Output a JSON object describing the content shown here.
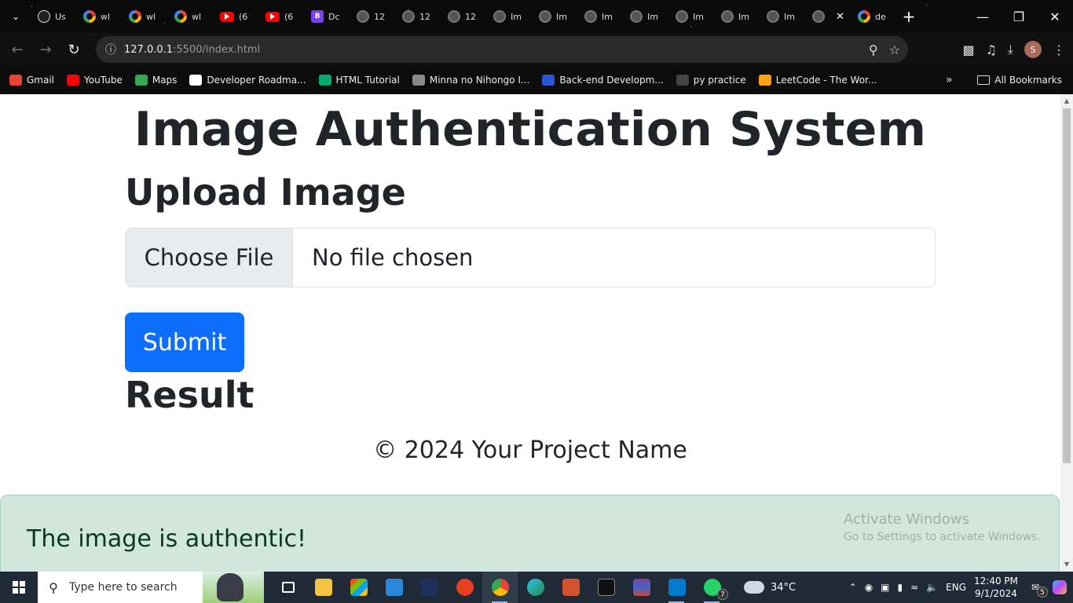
{
  "browser": {
    "tabs": [
      {
        "icon": "chatgpt-icon",
        "title": "Us"
      },
      {
        "icon": "google-icon",
        "title": "wl"
      },
      {
        "icon": "google-icon",
        "title": "wl"
      },
      {
        "icon": "google-icon",
        "title": "wl"
      },
      {
        "icon": "youtube-icon",
        "title": "(6"
      },
      {
        "icon": "youtube-icon",
        "title": "(6"
      },
      {
        "icon": "bootstrap-icon",
        "title": "Dc"
      },
      {
        "icon": "globe-icon",
        "title": "12"
      },
      {
        "icon": "globe-icon",
        "title": "12"
      },
      {
        "icon": "globe-icon",
        "title": "12"
      },
      {
        "icon": "globe-icon",
        "title": "Im"
      },
      {
        "icon": "globe-icon",
        "title": "Im"
      },
      {
        "icon": "globe-icon",
        "title": "Im"
      },
      {
        "icon": "globe-icon",
        "title": "Im"
      },
      {
        "icon": "globe-icon",
        "title": "Im"
      },
      {
        "icon": "globe-icon",
        "title": "Im"
      },
      {
        "icon": "globe-icon",
        "title": "Im"
      },
      {
        "icon": "globe-icon",
        "title": ""
      },
      {
        "icon": "google-icon",
        "title": "de"
      }
    ],
    "url_host": "127.0.0.1",
    "url_path": ":5500/index.html",
    "profile_initial": "S",
    "bookmarks": [
      {
        "label": "Gmail",
        "color": "#ea4335"
      },
      {
        "label": "YouTube",
        "color": "#ff0000"
      },
      {
        "label": "Maps",
        "color": "#34a853"
      },
      {
        "label": "Developer Roadma...",
        "color": "#ffffff"
      },
      {
        "label": "HTML Tutorial",
        "color": "#04aa6d"
      },
      {
        "label": "Minna no Nihongo I...",
        "color": "#888888"
      },
      {
        "label": "Back-end Developm...",
        "color": "#2b55d6"
      },
      {
        "label": "py practice",
        "color": "#444444"
      },
      {
        "label": "LeetCode - The Wor...",
        "color": "#ffa116"
      }
    ],
    "all_bookmarks": "All Bookmarks"
  },
  "page": {
    "title": "Image Authentication System",
    "upload_heading": "Upload Image",
    "choose_file": "Choose File",
    "file_status": "No file chosen",
    "submit": "Submit",
    "result_heading": "Result",
    "footer": "© 2024 Your Project Name",
    "alert": "The image is authentic!"
  },
  "watermark": {
    "title": "Activate Windows",
    "subtitle": "Go to Settings to activate Windows."
  },
  "taskbar": {
    "search_placeholder": "Type here to search",
    "weather": "34°C",
    "language": "ENG",
    "time": "12:40 PM",
    "date": "9/1/2024",
    "notifications": "5",
    "whatsapp_badge": "7"
  },
  "colors": {
    "primary": "#0d6efd",
    "alert_bg": "#d1e7dd",
    "alert_text": "#0a3622"
  }
}
